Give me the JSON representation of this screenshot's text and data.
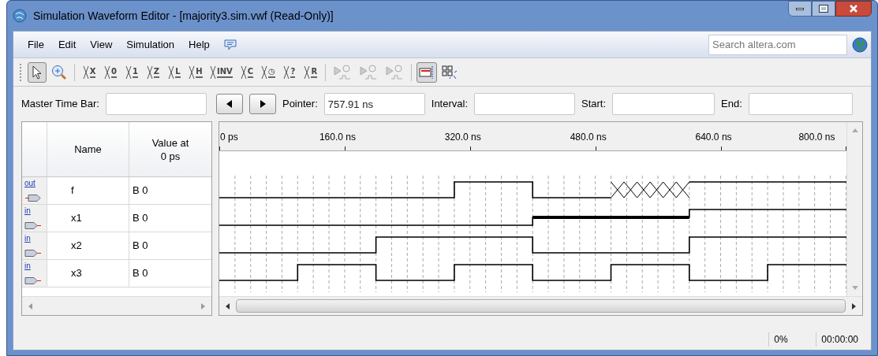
{
  "window": {
    "title": "Simulation Waveform Editor - [majority3.sim.vwf (Read-Only)]"
  },
  "menu": [
    "File",
    "Edit",
    "View",
    "Simulation",
    "Help"
  ],
  "search": {
    "placeholder": "Search altera.com"
  },
  "toolbar": [
    {
      "kind": "select",
      "selected": true
    },
    {
      "kind": "zoom",
      "selected": false
    },
    {
      "kind": "sep"
    },
    {
      "kind": "glyph",
      "glyph": "X",
      "selected": false
    },
    {
      "kind": "glyph",
      "glyph": "0",
      "selected": false
    },
    {
      "kind": "glyph",
      "glyph": "1",
      "selected": false
    },
    {
      "kind": "glyph",
      "glyph": "Z",
      "selected": false
    },
    {
      "kind": "glyph",
      "glyph": "L",
      "selected": false
    },
    {
      "kind": "glyph",
      "glyph": "H",
      "selected": false
    },
    {
      "kind": "glyph",
      "glyph": "INV",
      "selected": false
    },
    {
      "kind": "glyph",
      "glyph": "C",
      "selected": false
    },
    {
      "kind": "glyph",
      "glyph": "◷",
      "selected": false
    },
    {
      "kind": "glyph",
      "glyph": "?",
      "selected": false
    },
    {
      "kind": "glyph",
      "glyph": "R",
      "selected": false
    },
    {
      "kind": "sep"
    },
    {
      "kind": "run",
      "selected": false
    },
    {
      "kind": "run",
      "selected": false
    },
    {
      "kind": "run",
      "selected": false
    },
    {
      "kind": "sep"
    },
    {
      "kind": "snap",
      "selected": true
    },
    {
      "kind": "grid",
      "selected": false
    }
  ],
  "timebar": {
    "master_label": "Master Time Bar:",
    "pointer_label": "Pointer:",
    "pointer_value": "757.91 ns",
    "interval_label": "Interval:",
    "start_label": "Start:",
    "end_label": "End:"
  },
  "table": {
    "columns": [
      "Name",
      "Value at\n0 ps"
    ],
    "rows": [
      {
        "kind": "out",
        "direction": "out",
        "name": "f",
        "value": "B 0"
      },
      {
        "kind": "in",
        "direction": "in",
        "name": "x1",
        "value": "B 0"
      },
      {
        "kind": "in",
        "direction": "in",
        "name": "x2",
        "value": "B 0"
      },
      {
        "kind": "in",
        "direction": "in",
        "name": "x3",
        "value": "B 0"
      }
    ]
  },
  "ruler": [
    "0 ps",
    "160.0 ns",
    "320.0 ns",
    "480.0 ns",
    "640.0 ns",
    "800.0 ns"
  ],
  "status_bar": {
    "progress": "0%",
    "elapsed": "00:00:00"
  }
}
